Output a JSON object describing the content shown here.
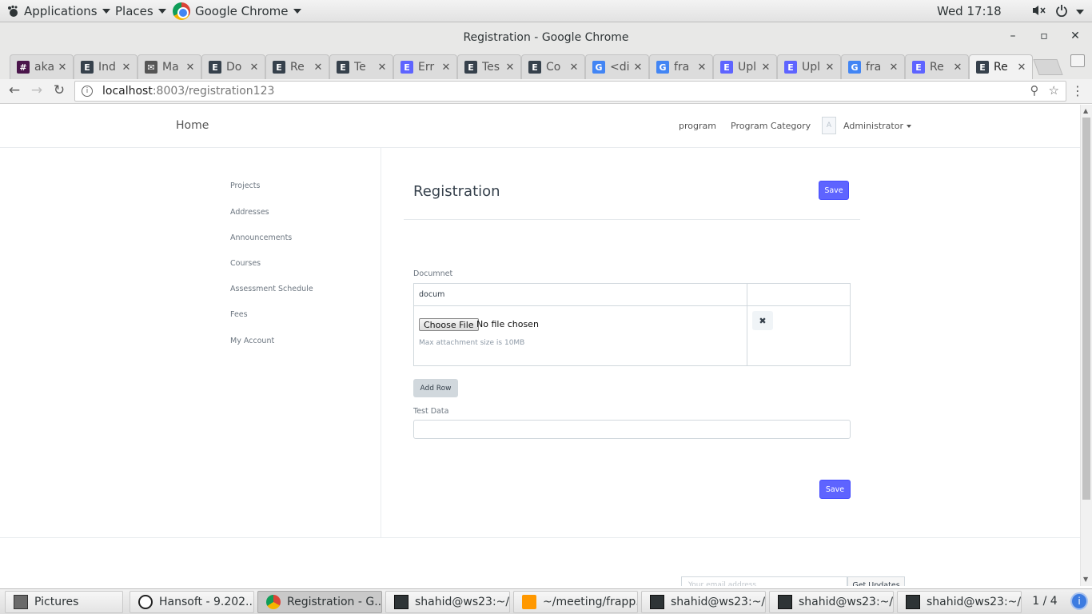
{
  "topbar": {
    "applications": "Applications",
    "places": "Places",
    "active_app": "Google Chrome",
    "clock": "Wed 17:18"
  },
  "window": {
    "title": "Registration - Google Chrome",
    "minimize_glyph": "–",
    "maximize_glyph": "▫",
    "close_glyph": "✕"
  },
  "tabs": [
    {
      "label": "aka",
      "icon": "slack-icon",
      "color": "#4a154b",
      "glyph": "#"
    },
    {
      "label": "Ind",
      "icon": "erpnext-icon",
      "color": "#36414c",
      "glyph": "E"
    },
    {
      "label": "Ma",
      "icon": "mail-icon",
      "color": "#555555",
      "glyph": "✉"
    },
    {
      "label": "Do",
      "icon": "erpnext-icon",
      "color": "#36414c",
      "glyph": "E"
    },
    {
      "label": "Re",
      "icon": "erpnext-icon",
      "color": "#36414c",
      "glyph": "E"
    },
    {
      "label": "Te",
      "icon": "erpnext-icon",
      "color": "#36414c",
      "glyph": "E"
    },
    {
      "label": "Err",
      "icon": "erpnext-icon",
      "color": "#5e64ff",
      "glyph": "E"
    },
    {
      "label": "Tes",
      "icon": "erpnext-icon",
      "color": "#36414c",
      "glyph": "E"
    },
    {
      "label": "Co",
      "icon": "erpnext-icon",
      "color": "#36414c",
      "glyph": "E"
    },
    {
      "label": "<di",
      "icon": "google-icon",
      "color": "#4285f4",
      "glyph": "G"
    },
    {
      "label": "fra",
      "icon": "google-icon",
      "color": "#4285f4",
      "glyph": "G"
    },
    {
      "label": "Upl",
      "icon": "erpnext-icon",
      "color": "#5e64ff",
      "glyph": "E"
    },
    {
      "label": "Upl",
      "icon": "erpnext-icon",
      "color": "#5e64ff",
      "glyph": "E"
    },
    {
      "label": "fra",
      "icon": "google-icon",
      "color": "#4285f4",
      "glyph": "G"
    },
    {
      "label": "Re",
      "icon": "erpnext-icon",
      "color": "#5e64ff",
      "glyph": "E"
    },
    {
      "label": "Re",
      "icon": "erpnext-icon",
      "color": "#36414c",
      "glyph": "E",
      "active": true
    }
  ],
  "address_bar": {
    "host": "localhost",
    "path": ":8003/registration123"
  },
  "site_nav": {
    "home": "Home",
    "program": "program",
    "program_category": "Program Category",
    "avatar_letter": "A",
    "user": "Administrator"
  },
  "sidebar": {
    "items": [
      "Projects",
      "Addresses",
      "Announcements",
      "Courses",
      "Assessment Schedule",
      "Fees",
      "My Account"
    ]
  },
  "form": {
    "title": "Registration",
    "save_label": "Save",
    "document_label": "Documnet",
    "document_value": "docum",
    "choose_file": "Choose File",
    "no_file": "No file chosen",
    "max_size": "Max attachment size is 10MB",
    "remove_glyph": "✖",
    "add_row": "Add Row",
    "test_data_label": "Test Data"
  },
  "footer": {
    "email_placeholder": "Your email address",
    "get_updates": "Get Updates"
  },
  "taskbar": {
    "items": [
      {
        "label": "Pictures",
        "icon": "pics"
      },
      {
        "label": "Hansoft - 9.202...",
        "icon": "hansoft"
      },
      {
        "label": "Registration - G...",
        "icon": "chrome",
        "active": true
      },
      {
        "label": "shahid@ws23:~/...",
        "icon": "term"
      },
      {
        "label": "~/meeting/frapp...",
        "icon": "sublime"
      },
      {
        "label": "shahid@ws23:~/...",
        "icon": "term"
      },
      {
        "label": "shahid@ws23:~/...",
        "icon": "term"
      },
      {
        "label": "shahid@ws23:~/...",
        "icon": "term"
      }
    ],
    "workspace": "1 / 4"
  },
  "colors": {
    "primary": "#5e64ff",
    "text": "#36414c",
    "muted": "#6c7680"
  }
}
